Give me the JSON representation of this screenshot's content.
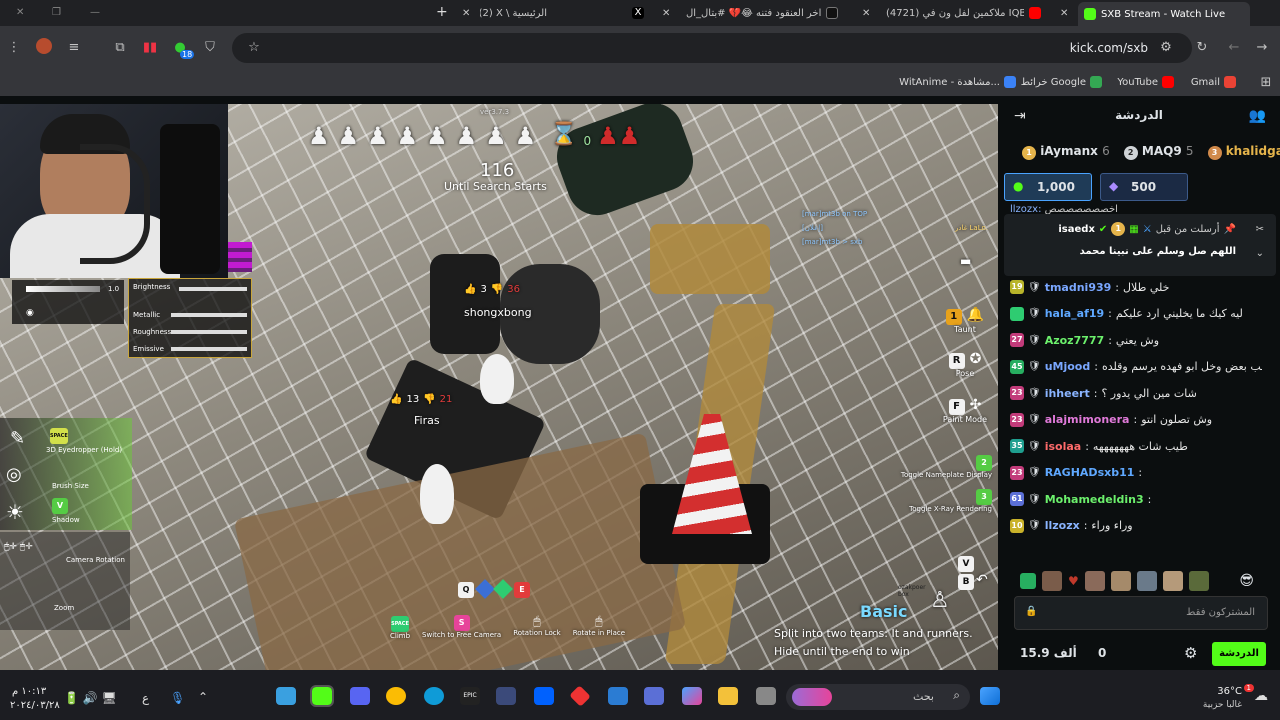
{
  "browser": {
    "tabs": [
      {
        "title": "SXB Stream - Watch Live on",
        "color": "#53fc18",
        "active": true
      },
      {
        "title": "(4721) ملاكمين لفل ون في IQB",
        "color": "#ff0000",
        "active": false
      },
      {
        "title": "اخر العنقود فتنه 😂💔 #بتال_ال",
        "color": "#111111",
        "active": false
      },
      {
        "title": "(2) X \\ الرئيسية",
        "color": "#000000",
        "active": false
      }
    ],
    "new_tab": "+",
    "close_glyph": "✕",
    "url": "kick.com/sxb",
    "extension_badge": "18",
    "bookmarks": [
      {
        "label": "Gmail",
        "color": "#ea4335"
      },
      {
        "label": "YouTube",
        "color": "#ff0000"
      },
      {
        "label": "خرائط Google",
        "color": "#34a853"
      },
      {
        "label": "WitAnime - مشاهدة...",
        "color": "#3b82f6"
      }
    ]
  },
  "game": {
    "version": "ver3.7.3",
    "runners_left": "8",
    "timer_count": "0",
    "countdown": "116",
    "countdown_label": "Until Search Starts",
    "top_right_text": [
      "[mar]mt3b on TOP",
      "[إعلان]",
      "[mar]mt3b > sxb"
    ],
    "lalo": "غادر LaLo.",
    "player1": {
      "name": "shongxbong",
      "likes": "3",
      "dislikes": "36"
    },
    "player2": {
      "name": "Firas",
      "likes": "13",
      "dislikes": "21"
    },
    "hud_slider": {
      "value": "1.0"
    },
    "sliders": [
      {
        "label": "Brightness"
      },
      {
        "label": "Metallic"
      },
      {
        "label": "Roughness"
      },
      {
        "label": "Emissive"
      }
    ],
    "tools": [
      {
        "label": "3D Eyedropper (Hold)",
        "key": "SPACE"
      },
      {
        "label": "Brush Size",
        "key": ""
      },
      {
        "label": "Shadow",
        "key": "V"
      }
    ],
    "bottom_left": [
      {
        "label": "Camera Rotation"
      },
      {
        "label": "Zoom"
      }
    ],
    "right_actions": [
      {
        "key": "1",
        "label": "Taunt"
      },
      {
        "key": "R",
        "label": "Pose"
      },
      {
        "key": "F",
        "label": "Paint Mode"
      }
    ],
    "toggles": [
      {
        "key": "2",
        "label": "Toggle Nameplate Display"
      },
      {
        "key": "3",
        "label": "Toggle X-Ray Rendering"
      }
    ],
    "bottom_keys": [
      {
        "key": "SPACE",
        "label": "Climb"
      },
      {
        "key": "S",
        "label": "Switch to Free Camera"
      },
      {
        "key": "",
        "label": "Rotation Lock"
      },
      {
        "key": "",
        "label": "Rotate in Place"
      }
    ],
    "mode": "Basic",
    "top_keys": [
      "V",
      "B"
    ],
    "watermark": "ozakpoer\nbox",
    "hint_line1": "Split into two teams: It and runners.",
    "hint_line2": "Hide until the end to win",
    "colors": {
      "green": "#2ecc71",
      "pink": "#e7449a",
      "red": "#e23b3b"
    }
  },
  "chat": {
    "title": "الدردشة",
    "leaderboard": [
      {
        "rank": "1",
        "name": "iAymanx",
        "count": "6",
        "color": "#e5b44b"
      },
      {
        "rank": "2",
        "name": "MAQ9",
        "count": "5",
        "color": "#cfd3d6"
      },
      {
        "rank": "3",
        "name": "khalidgar",
        "count": "",
        "color": "#d18a4b"
      }
    ],
    "goals": [
      {
        "value": "1,000"
      },
      {
        "value": "500"
      }
    ],
    "pinned": {
      "label": "أرسلت من قبل",
      "user": "isaedx",
      "text": "اللهم صل وسلم على نبينا محمد"
    },
    "partial_row": {
      "user": "llzozx",
      "text": "اخصصصصصصص"
    },
    "messages": [
      {
        "level": "19",
        "lvcolor": "#b8b42a",
        "user": "tmadni939",
        "ucolor": "#7aa7ff",
        "text": "خلي طلال"
      },
      {
        "level": "",
        "lvcolor": "#2ecc71",
        "user": "hala_af19",
        "ucolor": "#5fa8ff",
        "text": "ليه كيك ما يخليني ارد عليكم"
      },
      {
        "level": "27",
        "lvcolor": "#c23b7a",
        "user": "Azoz7777",
        "ucolor": "#6cf06c",
        "text": "وش يعني"
      },
      {
        "level": "45",
        "lvcolor": "#27ae60",
        "user": "uMjood",
        "ucolor": "#7aa7ff",
        "text": "اجلسو جمب بعض وخل ابو فهده يرسم وقلده"
      },
      {
        "level": "23",
        "lvcolor": "#c23b7a",
        "user": "ihheert",
        "ucolor": "#8ab4ff",
        "text": "شات مين الي يدور ؟"
      },
      {
        "level": "23",
        "lvcolor": "#c23b7a",
        "user": "alajmimonera",
        "ucolor": "#e07ad9",
        "text": "وش تصلون انتو"
      },
      {
        "level": "35",
        "lvcolor": "#1f9f8f",
        "user": "isolaa",
        "ucolor": "#ff6b6b",
        "text": "طيب شات هههههههه"
      },
      {
        "level": "23",
        "lvcolor": "#c23b7a",
        "user": "RAGHADsxb11",
        "ucolor": "#5fa8ff",
        "text": ""
      },
      {
        "level": "61",
        "lvcolor": "#5b6fd6",
        "user": "Mohamedeldin3",
        "ucolor": "#6cf06c",
        "text": ""
      },
      {
        "level": "10",
        "lvcolor": "#c9b22a",
        "user": "llzozx",
        "ucolor": "#8ab4ff",
        "text": "وراء وراء"
      }
    ],
    "placeholder": "المشتركون فقط",
    "viewers": "15.9 ألف",
    "count": "0",
    "send": "الدردشة",
    "accent": "#53fc18"
  },
  "taskbar": {
    "weather": "36°C",
    "weather_sub": "غالبا حزبية",
    "search": "بحث",
    "time": "١٠:١٣ م",
    "date": "٢٠٢٤/٠٣/٢٨",
    "lang": "ع",
    "badge": "1"
  }
}
